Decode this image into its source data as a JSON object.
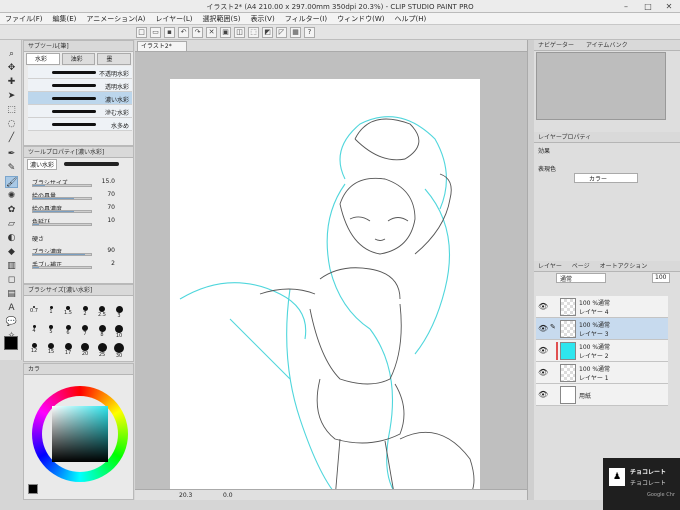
{
  "window": {
    "title": "イラスト2* (A4 210.00 x 297.00mm 350dpi 20.3%) - CLIP STUDIO PAINT PRO"
  },
  "menu": [
    "ファイル(F)",
    "編集(E)",
    "アニメーション(A)",
    "レイヤー(L)",
    "選択範囲(S)",
    "表示(V)",
    "フィルター(I)",
    "ウィンドウ(W)",
    "ヘルプ(H)"
  ],
  "canvas_tab": "イラスト2*",
  "subtool": {
    "header": "サブツール[筆]",
    "tabs": [
      "水彩",
      "油彩",
      "墨"
    ],
    "brushes": [
      "不透明水彩",
      "透明水彩",
      "濃い水彩",
      "滲む水彩",
      "水多め"
    ]
  },
  "tool_property": {
    "header": "ツールプロパティ[濃い水彩]",
    "brush_name": "濃い水彩",
    "rows": [
      {
        "label": "ブラシサイズ",
        "value": "15.0",
        "pct": 0.2
      },
      {
        "label": "絵の具量",
        "value": "70",
        "pct": 0.7
      },
      {
        "label": "絵の具濃度",
        "value": "70",
        "pct": 0.7
      },
      {
        "label": "色延び",
        "value": "10",
        "pct": 0.1
      },
      {
        "label": "硬さ",
        "value": "",
        "pct": 0.5
      },
      {
        "label": "ブラシ濃度",
        "value": "90",
        "pct": 0.9
      },
      {
        "label": "手ブレ補正",
        "value": "2",
        "pct": 0.1
      }
    ]
  },
  "brush_size": {
    "header": "ブラシサイズ[濃い水彩]",
    "sizes_row1": [
      "0.7",
      "1",
      "1.5",
      "2",
      "2.5",
      "3"
    ],
    "sizes_row2": [
      "4",
      "5",
      "6",
      "7",
      "8",
      "10"
    ],
    "sizes_row3": [
      "12",
      "15",
      "17",
      "20",
      "25",
      "30"
    ]
  },
  "color_header": "カラ",
  "layer_property": {
    "header": "レイヤープロパティ",
    "effect_label": "効果",
    "color_label": "表現色",
    "color_value": "カラー"
  },
  "navigator_tabs": [
    "ナビゲーター",
    "アイテムバンク"
  ],
  "layers_panel": {
    "tabs": [
      "レイヤー",
      "ページ",
      "オートアクション"
    ],
    "blend_mode": "通常",
    "opacity": "100",
    "layers": [
      {
        "line1": "100 %通常",
        "line2": "レイヤー 4"
      },
      {
        "line1": "100 %通常",
        "line2": "レイヤー 3"
      },
      {
        "line1": "100 %通常",
        "line2": "レイヤー 2"
      },
      {
        "line1": "100 %通常",
        "line2": "レイヤー 1"
      },
      {
        "line1": "",
        "line2": "用紙"
      }
    ]
  },
  "status": {
    "zoom": "20.3",
    "angle": "0.0"
  },
  "notification": {
    "title": "チョコレート",
    "body": "チョコレート",
    "source": "Google Chr"
  },
  "colors": {
    "accent": "#a9c9e6",
    "current_color": "#2ee6ee",
    "layer_color": "#e05050"
  }
}
